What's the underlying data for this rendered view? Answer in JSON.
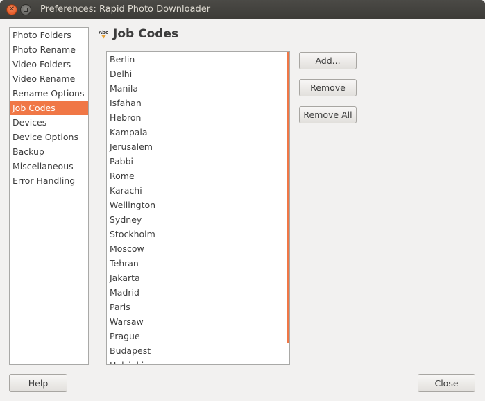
{
  "window": {
    "title": "Preferences: Rapid Photo Downloader"
  },
  "sidebar": {
    "items": [
      {
        "label": "Photo Folders"
      },
      {
        "label": "Photo Rename"
      },
      {
        "label": "Video Folders"
      },
      {
        "label": "Video Rename"
      },
      {
        "label": "Rename Options"
      },
      {
        "label": "Job Codes"
      },
      {
        "label": "Devices"
      },
      {
        "label": "Device Options"
      },
      {
        "label": "Backup"
      },
      {
        "label": "Miscellaneous"
      },
      {
        "label": "Error Handling"
      }
    ],
    "selected": "Job Codes"
  },
  "section": {
    "title": "Job Codes",
    "icon": "abc-pencil-icon"
  },
  "job_codes": [
    "Berlin",
    "Delhi",
    "Manila",
    "Isfahan",
    "Hebron",
    "Kampala",
    "Jerusalem",
    "Pabbi",
    "Rome",
    "Karachi",
    "Wellington",
    "Sydney",
    "Stockholm",
    "Moscow",
    "Tehran",
    "Jakarta",
    "Madrid",
    "Paris",
    "Warsaw",
    "Prague",
    "Budapest",
    "Helsinki"
  ],
  "buttons": {
    "add": "Add...",
    "remove": "Remove",
    "remove_all": "Remove All",
    "help": "Help",
    "close": "Close"
  },
  "colors": {
    "accent": "#f07746",
    "titlebar": "#3c3b37",
    "background": "#f2f1f0"
  }
}
